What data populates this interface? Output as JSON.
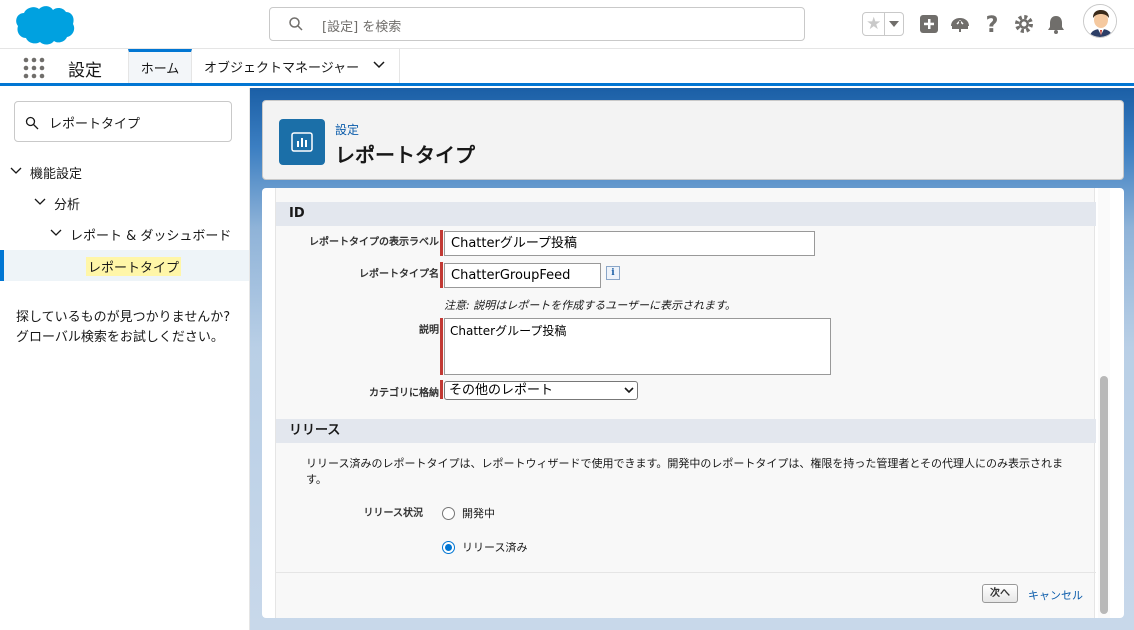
{
  "header": {
    "search_placeholder": "[設定] を検索",
    "icons": [
      "cloud-logo",
      "search-icon",
      "star-icon",
      "chevron-down-icon",
      "plus-icon",
      "trailhead-icon",
      "help-icon",
      "gear-icon",
      "bell-icon",
      "avatar"
    ]
  },
  "context_bar": {
    "app_name": "設定",
    "tabs": [
      {
        "label": "ホーム"
      },
      {
        "label": "オブジェクトマネージャー"
      }
    ]
  },
  "sidebar": {
    "quickfind_value": "レポートタイプ",
    "tree": [
      {
        "label": "機能設定"
      },
      {
        "label": "分析"
      },
      {
        "label": "レポート & ダッシュボード"
      },
      {
        "label": "レポートタイプ"
      }
    ],
    "not_found_line1": "探しているものが見つかりませんか?",
    "not_found_line2": "グローバル検索をお試しください。"
  },
  "page_header": {
    "subtitle": "設定",
    "title": "レポートタイプ"
  },
  "form": {
    "section_id": "ID",
    "label_display": "レポートタイプの表示ラベル",
    "value_display": "Chatterグループ投稿",
    "label_name": "レポートタイプ名",
    "value_name": "ChatterGroupFeed",
    "info_glyph": "i",
    "note": "注意: 説明はレポートを作成するユーザーに表示されます。",
    "label_desc": "説明",
    "value_desc": "Chatterグループ投稿",
    "label_category": "カテゴリに格納",
    "value_category": "その他のレポート",
    "section_release": "リリース",
    "release_desc": "リリース済みのレポートタイプは、レポートウィザードで使用できます。開発中のレポートタイプは、権限を持った管理者とその代理人にのみ表示されます。",
    "label_status": "リリース状況",
    "radio_dev": "開発中",
    "radio_released": "リリース済み",
    "selected_status": "リリース済み",
    "btn_next": "次へ",
    "btn_cancel": "キャンセル"
  },
  "colors": {
    "brand": "#0176d3",
    "required": "#c23934",
    "page_icon": "#1b6fa8"
  }
}
